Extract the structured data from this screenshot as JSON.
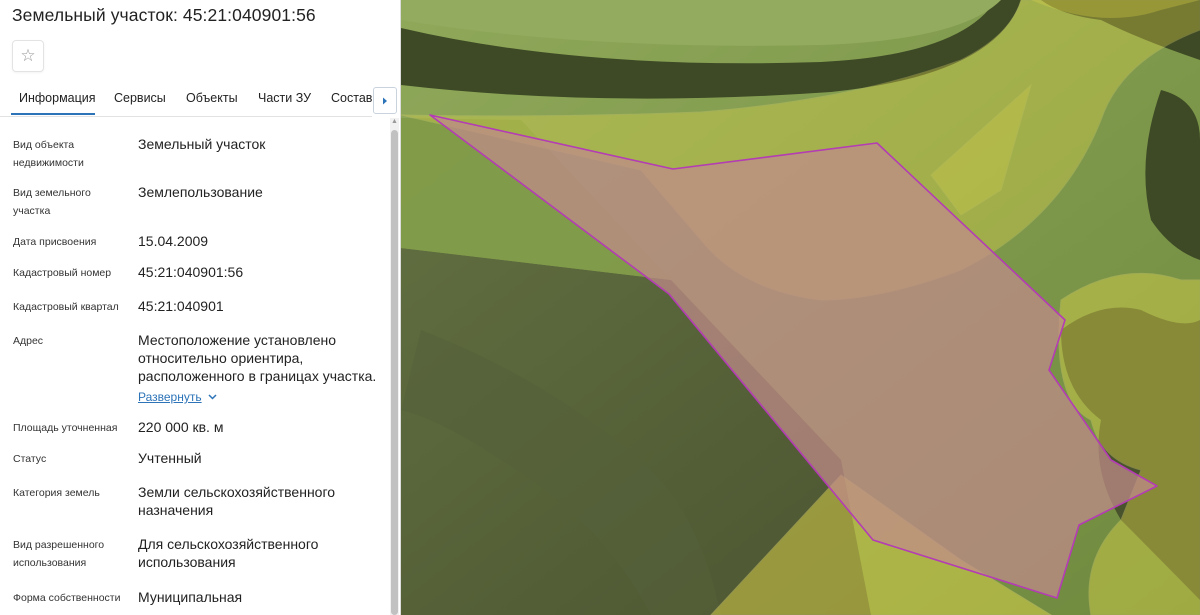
{
  "parcel": {
    "title": "Земельный участок: 45:21:040901:56",
    "favorite_icon": "star-icon"
  },
  "tabs": [
    {
      "label": "Информация",
      "active": true
    },
    {
      "label": "Сервисы"
    },
    {
      "label": "Объекты"
    },
    {
      "label": "Части ЗУ"
    },
    {
      "label": "Состав"
    }
  ],
  "tabs_next_icon": "chevron-right-icon",
  "rows": [
    {
      "label": "Вид объекта недвижимости",
      "value": "Земельный участок"
    },
    {
      "label": "Вид земельного участка",
      "value": "Землепользование"
    },
    {
      "label": "Дата присвоения",
      "value": "15.04.2009"
    },
    {
      "label": "Кадастровый номер",
      "value": "45:21:040901:56"
    },
    {
      "label": "Кадастровый квартал",
      "value": "45:21:040901"
    },
    {
      "label": "Адрес",
      "value": "Местоположение установлено относительно ориентира, расположенного в границах участка."
    },
    {
      "label": "Площадь уточненная",
      "value": "220 000 кв. м"
    },
    {
      "label": "Статус",
      "value": "Учтенный"
    },
    {
      "label": "Категория земель",
      "value": "Земли сельскохозяйственного назначения"
    },
    {
      "label": "Вид разрешенного использования",
      "value": "Для сельскохозяйственного использования"
    },
    {
      "label": "Форма собственности",
      "value": "Муниципальная"
    }
  ],
  "address_expand_label": "Развернуть",
  "colors": {
    "accent": "#2c73b8",
    "parcel_outline": "#b43cb4",
    "parcel_fill": "#c08a8a",
    "zone_fill": "#e2d84a"
  }
}
